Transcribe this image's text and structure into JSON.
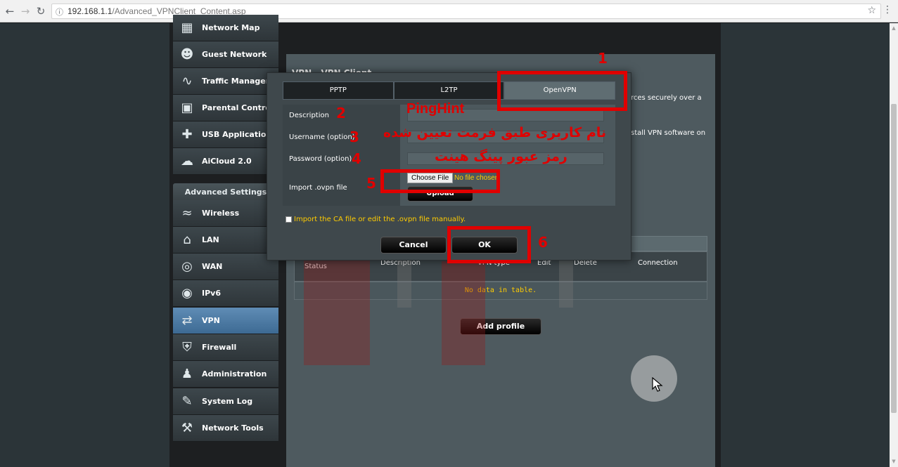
{
  "browser": {
    "url_host": "192.168.1.1",
    "url_path": "/Advanced_VPNClient_Content.asp"
  },
  "sidebar": {
    "top_items": [
      {
        "label": "Network Map",
        "icon": "network-map-icon"
      },
      {
        "label": "Guest Network",
        "icon": "guest-network-icon"
      },
      {
        "label": "Traffic Manager",
        "icon": "traffic-manager-icon"
      },
      {
        "label": "Parental Controls",
        "icon": "parental-controls-icon"
      },
      {
        "label": "USB Application",
        "icon": "usb-application-icon"
      },
      {
        "label": "AiCloud 2.0",
        "icon": "aicloud-icon"
      }
    ],
    "advanced_header": "Advanced Settings",
    "advanced_items": [
      {
        "label": "Wireless",
        "icon": "wireless-icon"
      },
      {
        "label": "LAN",
        "icon": "lan-icon"
      },
      {
        "label": "WAN",
        "icon": "wan-icon"
      },
      {
        "label": "IPv6",
        "icon": "ipv6-icon"
      },
      {
        "label": "VPN",
        "icon": "vpn-icon",
        "active": true
      },
      {
        "label": "Firewall",
        "icon": "firewall-icon"
      },
      {
        "label": "Administration",
        "icon": "administration-icon"
      },
      {
        "label": "System Log",
        "icon": "system-log-icon"
      },
      {
        "label": "Network Tools",
        "icon": "network-tools-icon"
      }
    ]
  },
  "main": {
    "title": "VPN - VPN Client",
    "desc_line1": "rces securely over a",
    "desc_line2": "stall VPN software on",
    "table": {
      "columns": [
        "Status",
        "Description",
        "VPN type",
        "Edit",
        "Delete",
        "Connection"
      ],
      "empty_text": "No data in table."
    },
    "add_profile_label": "Add profile"
  },
  "dialog": {
    "tabs": [
      "PPTP",
      "L2TP",
      "OpenVPN"
    ],
    "selected_tab": "OpenVPN",
    "fields": {
      "description_label": "Description",
      "username_label": "Username (option)",
      "password_label": "Password (option)",
      "import_label": "Import .ovpn file"
    },
    "choose_file_label": "Choose File",
    "no_file_text": "No file chosen",
    "upload_label": "Upload",
    "import_ca_text": "Import the CA file or edit the .ovpn file manually.",
    "cancel_label": "Cancel",
    "ok_label": "OK"
  },
  "annotations": {
    "numbers": [
      "1",
      "2",
      "3",
      "4",
      "5",
      "6"
    ],
    "brand": "PingHint",
    "username_note": "نام کاربری طبق فرمت تعیین شده",
    "password_note": "رمز عبور پینگ هینت",
    "color": "#e00000"
  }
}
